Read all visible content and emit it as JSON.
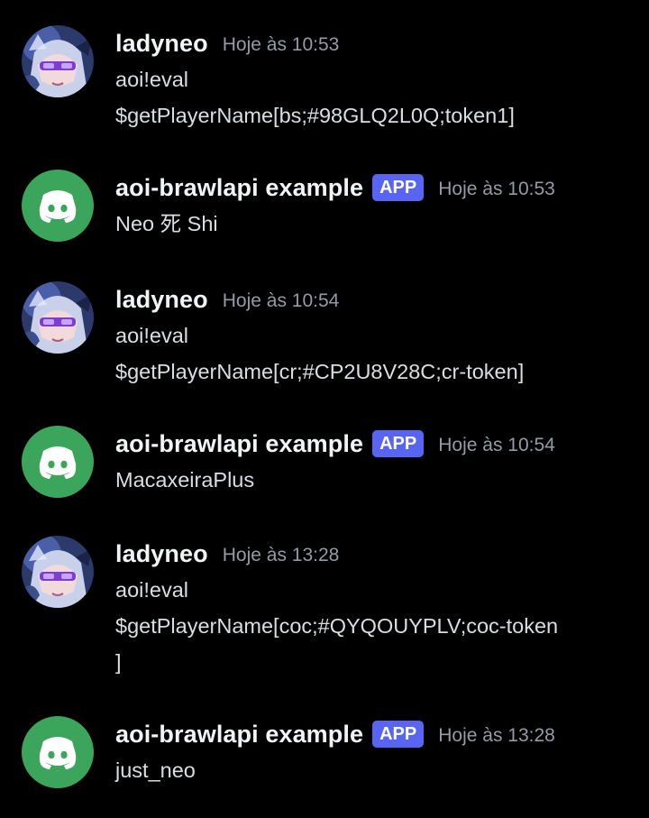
{
  "messages": [
    {
      "author": "ladyneo",
      "is_app": false,
      "timestamp": "Hoje às 10:53",
      "lines": [
        "aoi!eval",
        "$getPlayerName[bs;#98GLQ2L0Q;token1]"
      ]
    },
    {
      "author": "aoi-brawlapi example",
      "is_app": true,
      "badge": "APP",
      "timestamp": "Hoje às 10:53",
      "lines": [
        "Neo 死 Shi"
      ]
    },
    {
      "author": "ladyneo",
      "is_app": false,
      "timestamp": "Hoje às 10:54",
      "lines": [
        "aoi!eval",
        "$getPlayerName[cr;#CP2U8V28C;cr-token]"
      ]
    },
    {
      "author": "aoi-brawlapi example",
      "is_app": true,
      "badge": "APP",
      "timestamp": "Hoje às 10:54",
      "lines": [
        "MacaxeiraPlus"
      ]
    },
    {
      "author": "ladyneo",
      "is_app": false,
      "timestamp": "Hoje às 13:28",
      "lines": [
        "aoi!eval",
        "$getPlayerName[coc;#QYQOUYPLV;coc-token",
        "]"
      ]
    },
    {
      "author": "aoi-brawlapi example",
      "is_app": true,
      "badge": "APP",
      "timestamp": "Hoje às 13:28",
      "lines": [
        "just_neo"
      ]
    }
  ],
  "colors": {
    "background": "#000000",
    "username": "#f2f3f5",
    "timestamp": "#949ba4",
    "message_text": "#dbdee1",
    "app_badge": "#5865f2",
    "discord_avatar_bg": "#3ba55c"
  },
  "icons": {
    "user_avatar": "anime-girl-avatar",
    "app_avatar": "discord-logo-icon"
  }
}
